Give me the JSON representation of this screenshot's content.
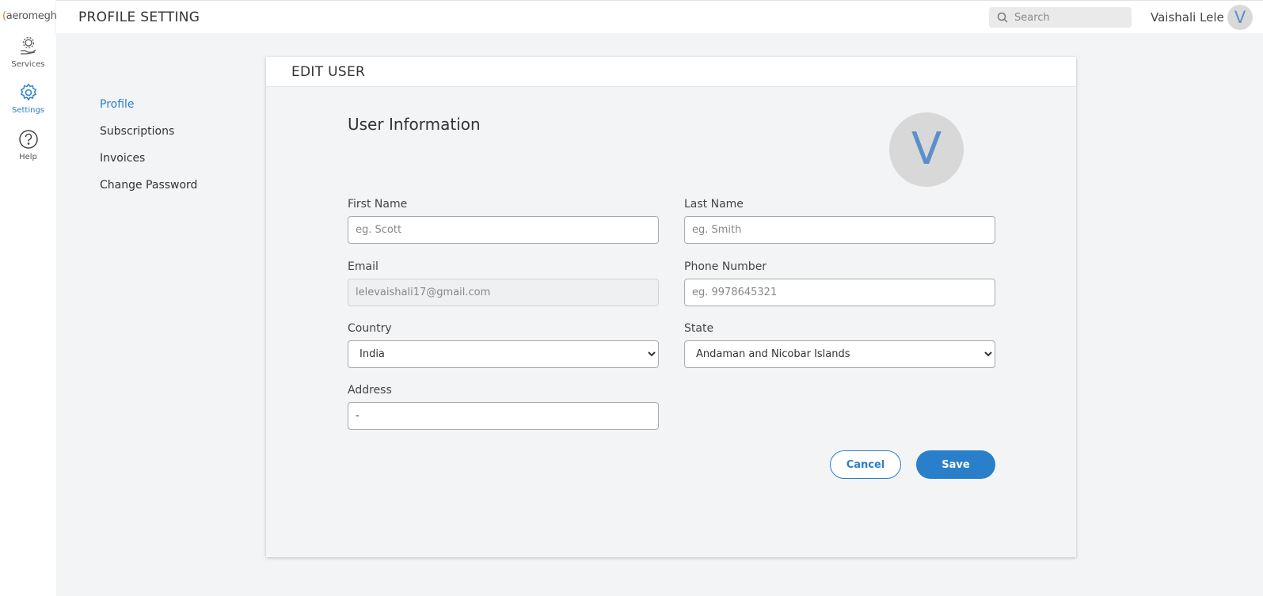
{
  "app": {
    "logo_text": "aeromegh",
    "page_title": "PROFILE SETTING"
  },
  "rail": {
    "items": [
      {
        "label": "Services",
        "icon": "services-icon"
      },
      {
        "label": "Settings",
        "icon": "gear-icon"
      },
      {
        "label": "Help",
        "icon": "help-icon"
      }
    ]
  },
  "header": {
    "search_placeholder": "Search",
    "user_name": "Vaishali Lele",
    "avatar_initial": "V"
  },
  "settings_nav": {
    "items": [
      "Profile",
      "Subscriptions",
      "Invoices",
      "Change Password"
    ],
    "active": "Profile"
  },
  "card": {
    "title": "EDIT USER",
    "section_title": "User Information",
    "avatar_initial": "V",
    "fields": {
      "first_name": {
        "label": "First Name",
        "placeholder": "eg. Scott",
        "value": ""
      },
      "last_name": {
        "label": "Last Name",
        "placeholder": "eg. Smith",
        "value": ""
      },
      "email": {
        "label": "Email",
        "placeholder": "lelevaishali17@gmail.com",
        "value": ""
      },
      "phone": {
        "label": "Phone Number",
        "placeholder": "eg. 9978645321",
        "value": ""
      },
      "country": {
        "label": "Country",
        "selected": "India"
      },
      "state": {
        "label": "State",
        "selected": "Andaman and Nicobar Islands"
      },
      "address": {
        "label": "Address",
        "value": "-"
      }
    },
    "buttons": {
      "cancel": "Cancel",
      "save": "Save"
    }
  },
  "colors": {
    "accent": "#2a7fca",
    "avatar_bg": "#d8d8d8",
    "page_bg": "#f3f4f6"
  }
}
